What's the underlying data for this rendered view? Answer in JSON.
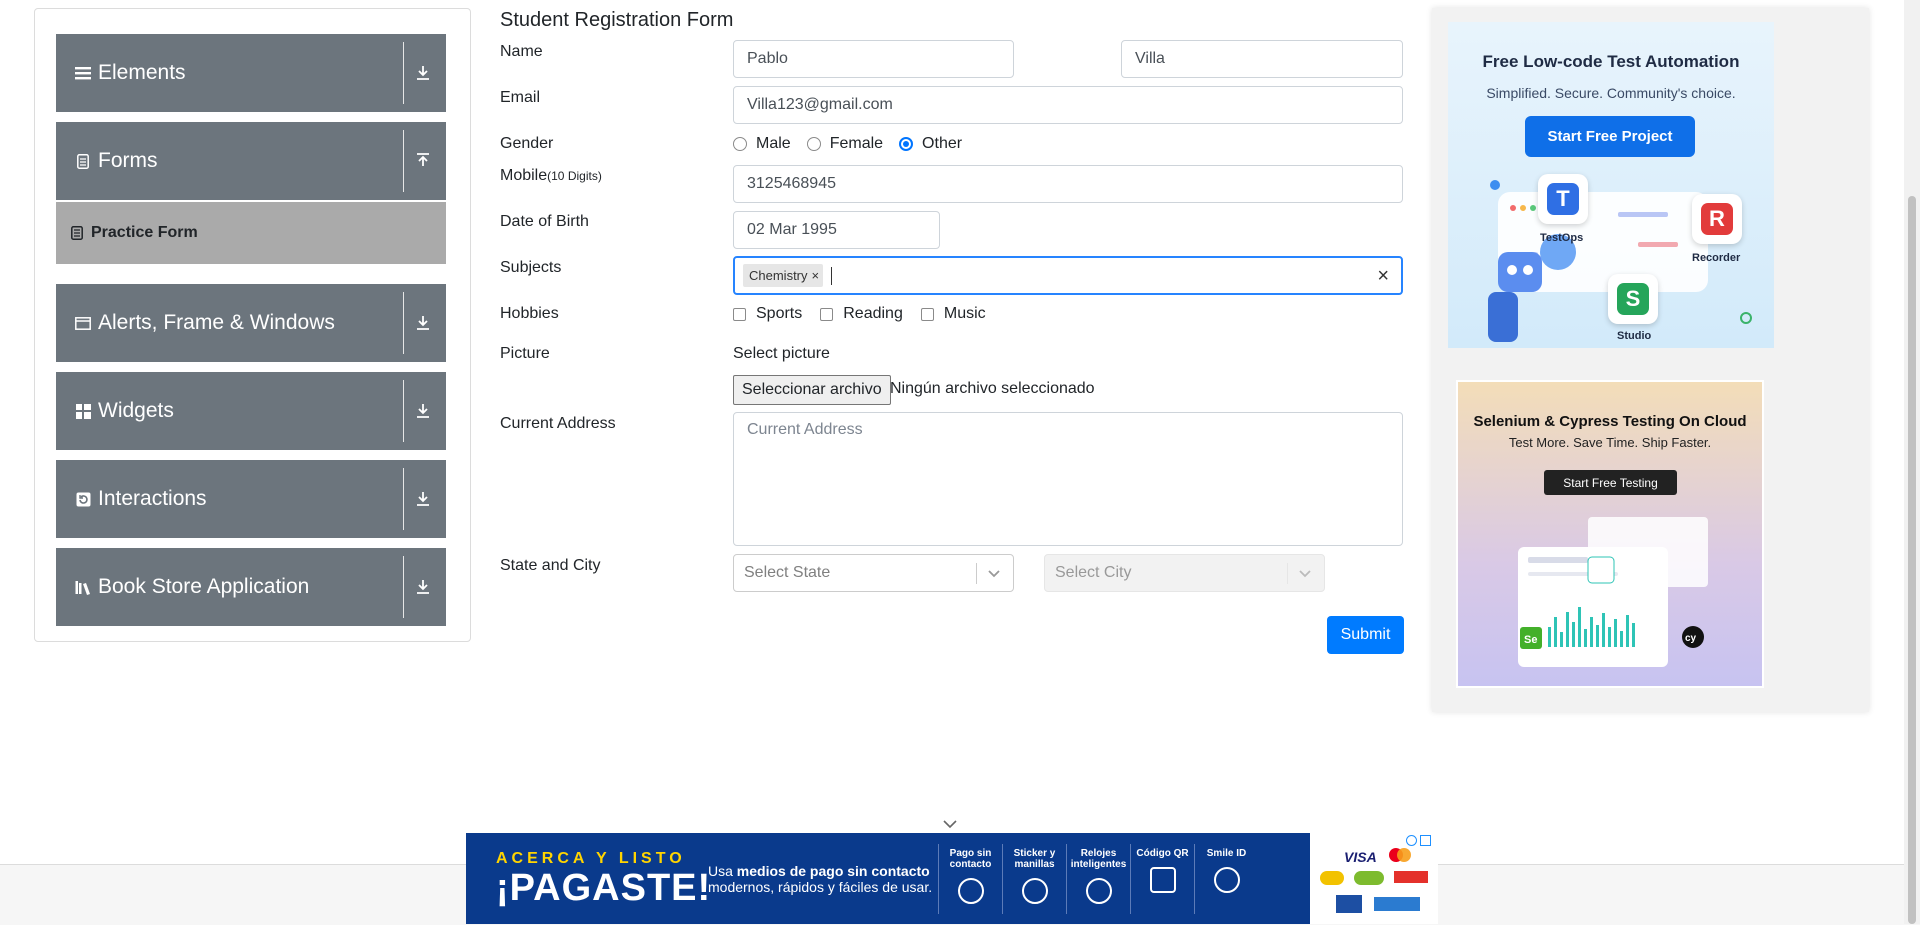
{
  "sidebar": {
    "groups": [
      {
        "label": "Elements",
        "icon": "menu-icon",
        "arrow": "download-icon"
      },
      {
        "label": "Forms",
        "icon": "document-icon",
        "arrow": "upload-icon"
      },
      {
        "label": "Alerts, Frame & Windows",
        "icon": "window-icon",
        "arrow": "download-icon"
      },
      {
        "label": "Widgets",
        "icon": "grid-icon",
        "arrow": "download-icon"
      },
      {
        "label": "Interactions",
        "icon": "interaction-icon",
        "arrow": "download-icon"
      },
      {
        "label": "Book Store Application",
        "icon": "books-icon",
        "arrow": "download-icon"
      }
    ],
    "active_item": {
      "label": "Practice Form",
      "icon": "form-icon"
    }
  },
  "form": {
    "title": "Student Registration Form",
    "name_label": "Name",
    "first_name": "Pablo",
    "last_name": "Villa",
    "email_label": "Email",
    "email": "Villa123@gmail.com",
    "gender_label": "Gender",
    "gender_options": [
      "Male",
      "Female",
      "Other"
    ],
    "gender_selected": "Other",
    "mobile_label": "Mobile",
    "mobile_hint": "(10 Digits)",
    "mobile": "3125468945",
    "dob_label": "Date of Birth",
    "dob": "02 Mar 1995",
    "subjects_label": "Subjects",
    "subjects": [
      "Chemistry"
    ],
    "subject_remove": "×",
    "subjects_clear": "×",
    "hobbies_label": "Hobbies",
    "hobbies": [
      "Sports",
      "Reading",
      "Music"
    ],
    "picture_label": "Picture",
    "picture_prompt": "Select picture",
    "file_button": "Seleccionar archivo",
    "file_status": "Ningún archivo seleccionado",
    "address_label": "Current Address",
    "address_placeholder": "Current Address",
    "state_city_label": "State and City",
    "state_placeholder": "Select State",
    "city_placeholder": "Select City",
    "submit": "Submit"
  },
  "ads": {
    "ad1": {
      "title": "Free Low-code Test Automation",
      "subtitle": "Simplified. Secure. Community's choice.",
      "button": "Start Free Project",
      "tiles": [
        "TestOps",
        "Recorder",
        "Studio"
      ]
    },
    "ad2": {
      "title": "Selenium & Cypress Testing On Cloud",
      "subtitle": "Test More. Save Time. Ship Faster.",
      "button": "Start Free Testing"
    }
  },
  "banner": {
    "tagline": "ACERCA Y LISTO",
    "headline": "¡PAGASTE!",
    "desc_prefix": "Usa ",
    "desc_bold": "medios de pago sin contacto",
    "desc_suffix": " modernos, rápidos y fáciles de usar.",
    "features": [
      "Pago sin contacto",
      "Sticker y manillas",
      "Relojes inteligentes",
      "Código QR",
      "Smile ID"
    ],
    "card_brands": [
      "VISA"
    ]
  },
  "colors": {
    "sidebar_header": "#6c757d",
    "sidebar_active": "#aaaaaa",
    "primary": "#007bff",
    "focus": "#2684ff",
    "banner_bg": "#0a3a8c"
  }
}
